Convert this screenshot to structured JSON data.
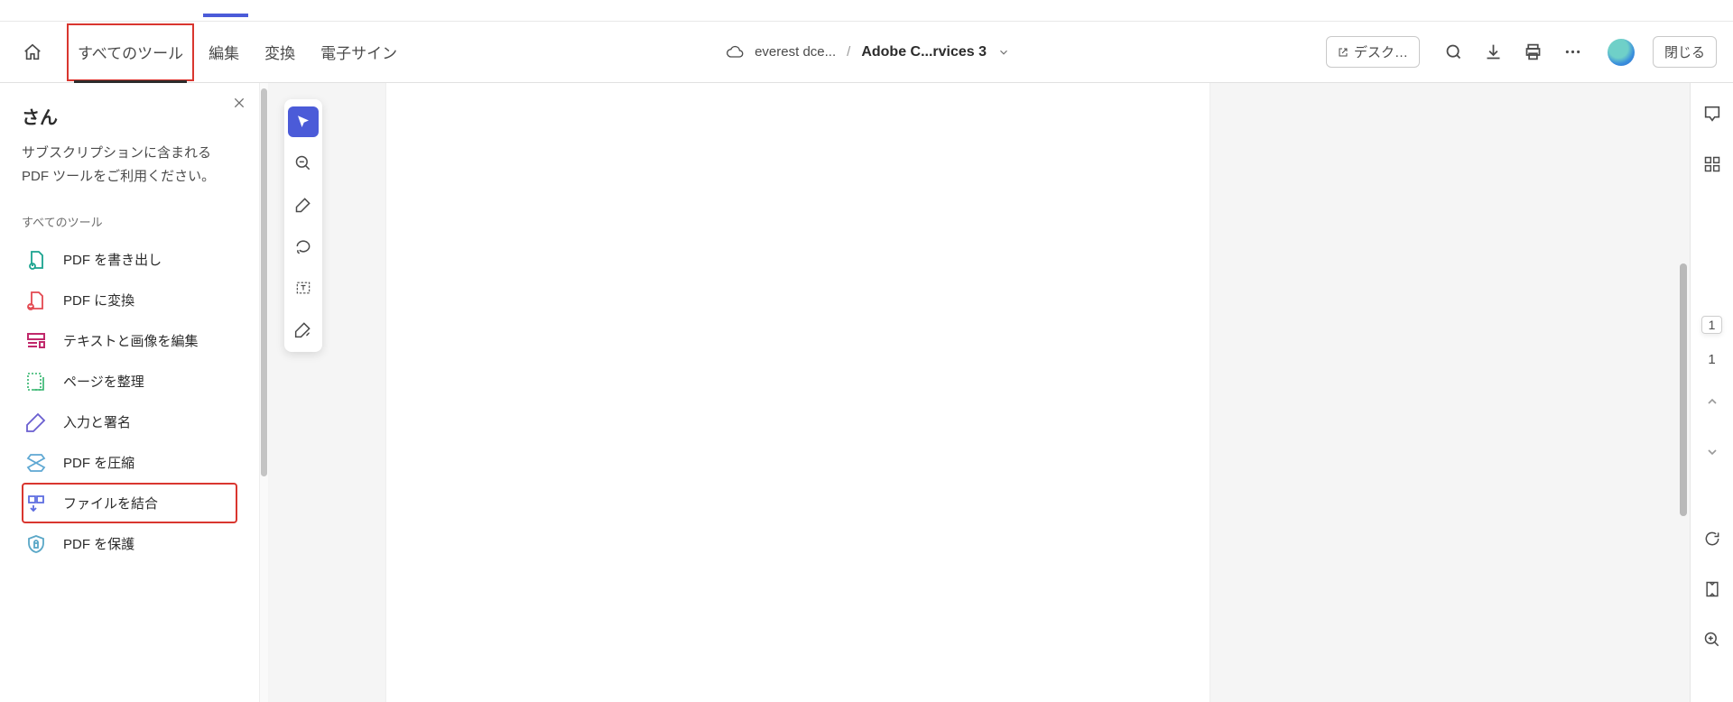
{
  "header": {
    "navTabs": [
      "すべてのツール",
      "編集",
      "変換",
      "電子サイン"
    ],
    "activeTab": 0,
    "breadcrumb": {
      "fileSource": "everest dce...",
      "separator": "/",
      "docName": "Adobe C...rvices 3"
    },
    "desktopButton": "デスク…",
    "closeButton": "閉じる"
  },
  "sidebar": {
    "title": "さん",
    "description": "サブスクリプションに含まれる PDF ツールをご利用ください。",
    "sectionLabel": "すべてのツール",
    "tools": [
      {
        "label": "PDF を書き出し",
        "icon": "export-pdf",
        "color": "#1aa38f"
      },
      {
        "label": "PDF に変換",
        "icon": "convert-pdf",
        "color": "#e34850"
      },
      {
        "label": "テキストと画像を編集",
        "icon": "edit-text-image",
        "color": "#c1286b"
      },
      {
        "label": "ページを整理",
        "icon": "organize-pages",
        "color": "#2fb36a"
      },
      {
        "label": "入力と署名",
        "icon": "fill-sign",
        "color": "#6a5ed0"
      },
      {
        "label": "PDF を圧縮",
        "icon": "compress-pdf",
        "color": "#5fa8d3"
      },
      {
        "label": "ファイルを結合",
        "icon": "combine-files",
        "color": "#5c6ce0"
      },
      {
        "label": "PDF を保護",
        "icon": "protect-pdf",
        "color": "#5aa7c7"
      }
    ],
    "highlightIndex": 6
  },
  "floatToolbar": {
    "items": [
      "select",
      "zoom-out",
      "draw",
      "lasso",
      "text-box",
      "sign"
    ],
    "activeIndex": 0
  },
  "rightRail": {
    "currentPage": "1",
    "totalPages": "1"
  }
}
